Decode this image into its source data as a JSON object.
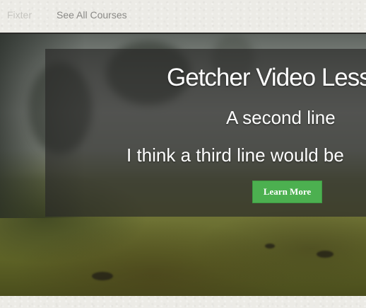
{
  "nav": {
    "links": [
      {
        "label": "Fixter"
      },
      {
        "label": "See All Courses"
      }
    ]
  },
  "hero": {
    "headline": "Getcher Video Less",
    "line_two": "A second line",
    "line_three": "I think a third line would be",
    "cta_label": "Learn More",
    "cta_color": "#4cb050",
    "panel_color": "#2a2a28"
  }
}
